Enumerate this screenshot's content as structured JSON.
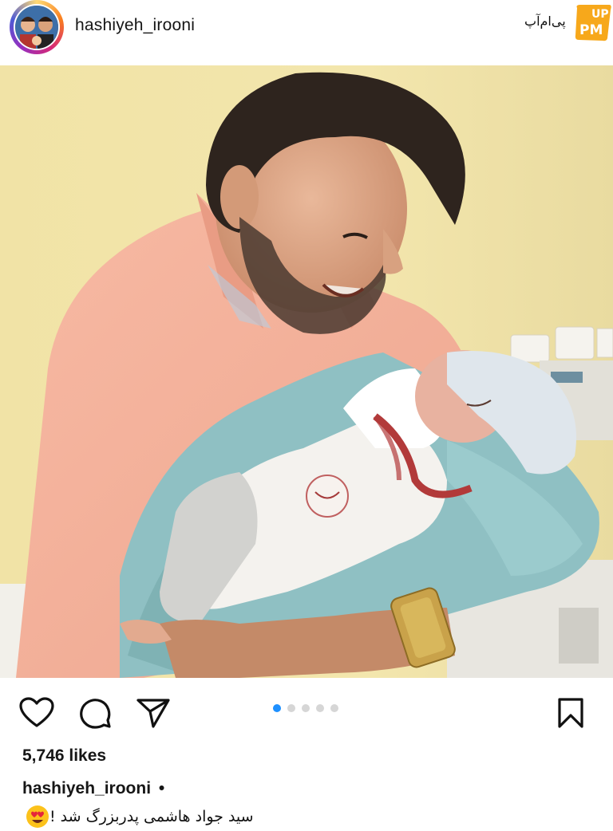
{
  "header": {
    "username": "hashiyeh_irooni",
    "logo_text": "پی‌ام‌آپ",
    "logo_badge": "PM",
    "logo_badge_top": "UP",
    "logo_color": "#f7a81b"
  },
  "post": {
    "image_alt": "photo",
    "carousel": {
      "count": 5,
      "active_index": 0,
      "active_color": "#1e90ff"
    }
  },
  "actions": {
    "like_icon": "heart-icon",
    "comment_icon": "comment-icon",
    "share_icon": "send-icon",
    "save_icon": "bookmark-icon"
  },
  "stats": {
    "likes_text": "5,746 likes"
  },
  "caption": {
    "username": "hashiyeh_irooni",
    "separator": "•",
    "text": "سید جواد هاشمی پدربزرگ شد !",
    "emoji": "heart-eyes-emoji"
  }
}
